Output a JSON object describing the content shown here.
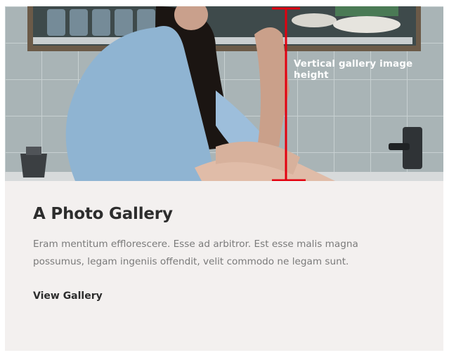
{
  "gallery": {
    "image_alt": "Woman in a blue shirt sitting in a kitchen",
    "annotation_label": "Vertical gallery image height",
    "annotation_color": "#e3000f",
    "title": "A Photo Gallery",
    "description": "Eram mentitum efflorescere. Esse ad arbitror. Est esse malis magna possumus, legam ingeniis offendit, velit commodo ne legam sunt.",
    "link_label": "View Gallery"
  }
}
